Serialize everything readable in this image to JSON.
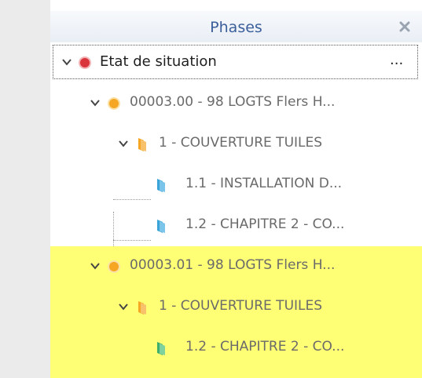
{
  "panel": {
    "title": "Phases",
    "close_icon": "close-icon"
  },
  "tree": {
    "items": [
      {
        "label": "Etat de situation",
        "more": "...",
        "icon": "red-circle-icon",
        "level": 0
      },
      {
        "label": "00003.00 - 98 LOGTS Flers H...",
        "icon": "orange-circle-icon",
        "level": 1
      },
      {
        "label": "1 - COUVERTURE TUILES",
        "icon": "orange-folder-icon",
        "level": 2
      },
      {
        "label": "1.1 - INSTALLATION D...",
        "icon": "blue-folder-icon",
        "level": 3
      },
      {
        "label": "1.2 - CHAPITRE 2 - CO...",
        "icon": "blue-folder-icon",
        "level": 3
      },
      {
        "label": "00003.01 - 98 LOGTS Flers H...",
        "icon": "orange-circle-icon",
        "level": 1
      },
      {
        "label": "1 - COUVERTURE TUILES",
        "icon": "orange-folder-icon",
        "level": 2
      },
      {
        "label": "1.2 - CHAPITRE 2 - CO...",
        "icon": "green-folder-icon",
        "level": 3
      }
    ]
  },
  "colors": {
    "highlight": "#ffff75",
    "title": "#3a5f9b",
    "red": "#d9343b",
    "orange": "#f5a623",
    "blue_folder": "#3aa3d8",
    "green_folder": "#3fae6a"
  }
}
